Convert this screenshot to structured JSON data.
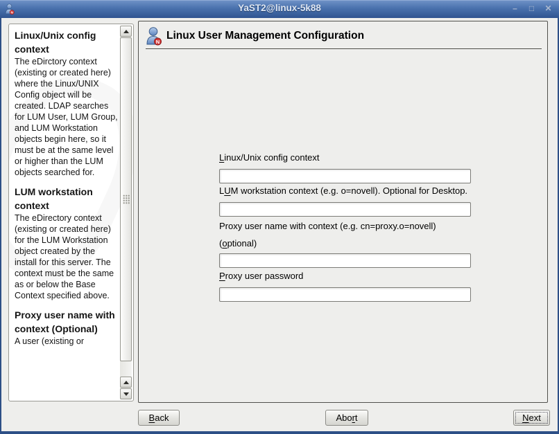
{
  "window": {
    "title": "YaST2@linux-5k88",
    "icon": "user-with-badge-icon",
    "controls": {
      "minimize": "–",
      "maximize": "□",
      "close": "✕"
    }
  },
  "colors": {
    "titlebar_top": "#7093c7",
    "titlebar_bottom": "#2f5490",
    "frame": "#2d4f86",
    "background": "#eeeeec",
    "badge_red": "#d23a3a",
    "person_blue": "#5d85c0"
  },
  "sidebar": {
    "scrollbar": {
      "up_arrow": "▲",
      "down_arrow": "▼"
    },
    "sections": [
      {
        "heading": "Linux/Unix config context",
        "body": "The eDirctory context (existing or created here) where the Linux/UNIX Config object will be created. LDAP searches for LUM User, LUM Group, and LUM Workstation objects begin here, so it must be at the same level or higher than the LUM objects searched for."
      },
      {
        "heading": "LUM workstation context",
        "body": "The eDirectory context (existing or created here) for the LUM Workstation object created by the install for this server. The context must be the same as or below the Base Context specified above."
      },
      {
        "heading": "Proxy user name with context (Optional)",
        "body": "A user (existing or"
      }
    ]
  },
  "main": {
    "title": "Linux User Management Configuration",
    "icon": "user-with-badge-icon",
    "fields": [
      {
        "pre": "",
        "mn": "L",
        "post": "inux/Unix config context",
        "value": ""
      },
      {
        "pre": "L",
        "mn": "U",
        "post": "M workstation context (e.g. o=novell). Optional for Desktop.",
        "value": ""
      },
      {
        "line1": "Proxy user name with context (e.g. cn=proxy.o=novell)",
        "pre": "(",
        "mn": "o",
        "post": "ptional)",
        "value": ""
      },
      {
        "pre": "",
        "mn": "P",
        "post": "roxy user password",
        "value": ""
      }
    ]
  },
  "footer": {
    "back": {
      "pre": "",
      "mn": "B",
      "post": "ack"
    },
    "abort": {
      "pre": "Abo",
      "mn": "r",
      "post": "t"
    },
    "next": {
      "pre": "",
      "mn": "N",
      "post": "ext"
    }
  }
}
